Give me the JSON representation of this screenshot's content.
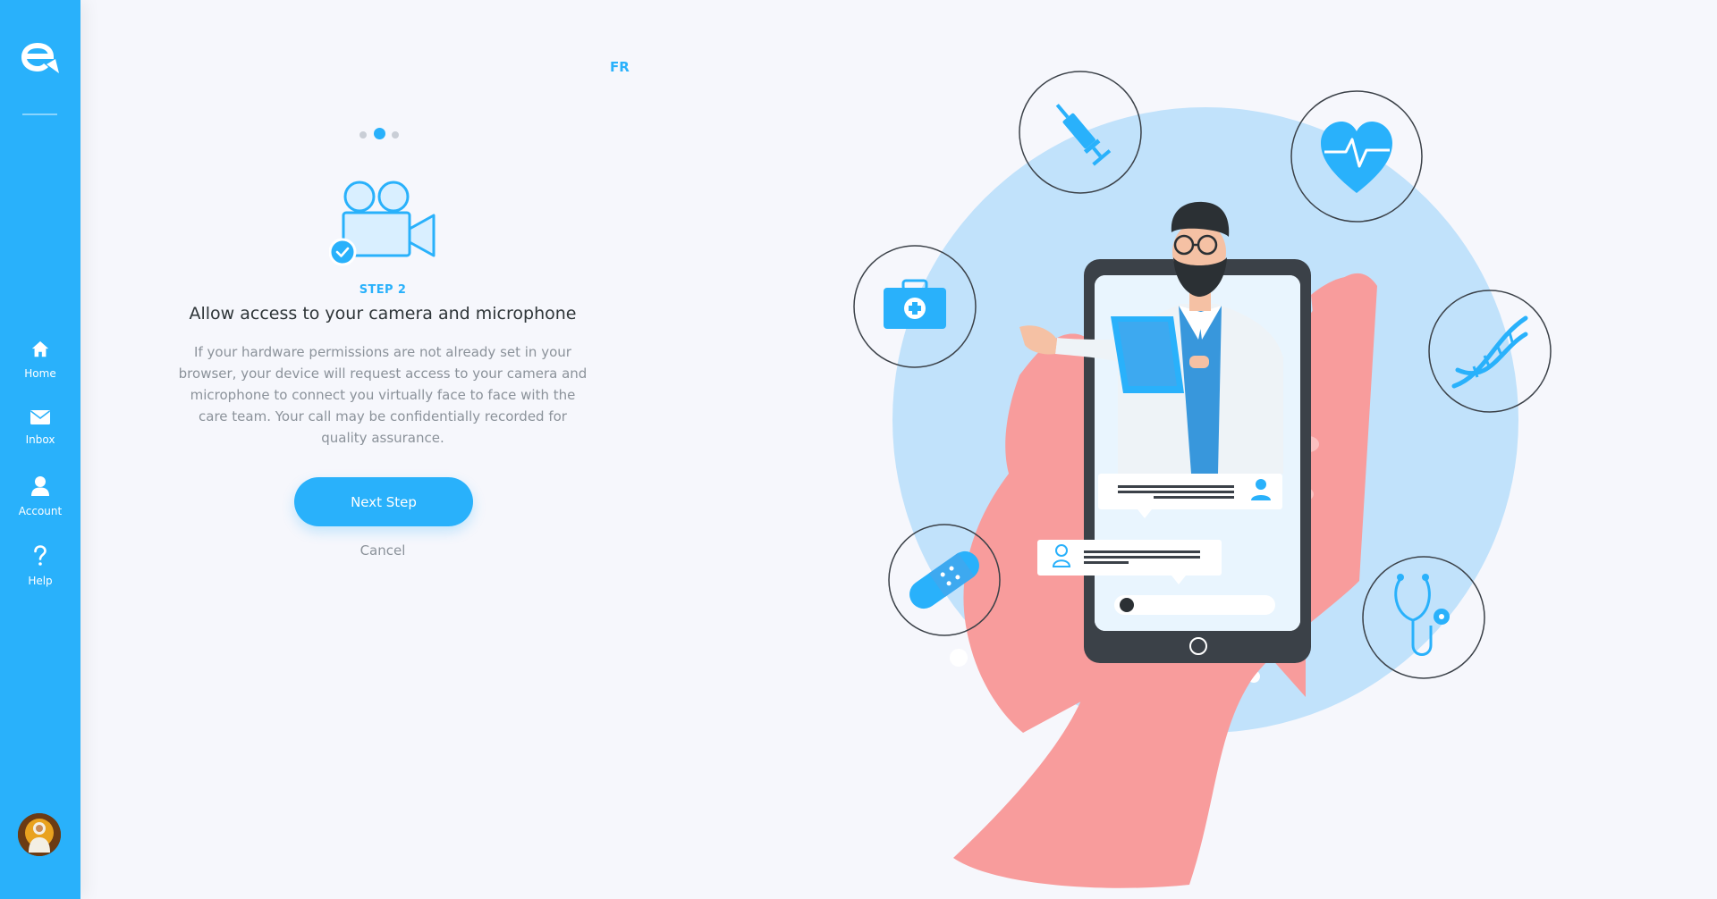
{
  "sidebar": {
    "items": [
      {
        "label": "Home"
      },
      {
        "label": "Inbox"
      },
      {
        "label": "Account"
      },
      {
        "label": "Help"
      }
    ]
  },
  "language_toggle": "FR",
  "stepper": {
    "total": 3,
    "current": 2
  },
  "step": {
    "label": "STEP 2",
    "title": "Allow access to your camera and microphone",
    "description": "If your hardware permissions are not already set in your browser, your device will request access to your camera and microphone to connect you virtually face to face with the care team. Your call may be confidentially recorded for quality assurance."
  },
  "actions": {
    "next": "Next Step",
    "cancel": "Cancel"
  },
  "colors": {
    "primary": "#29b1fb",
    "background": "#f6f7fc",
    "text_dark": "#2e3538",
    "text_muted": "#8b929a"
  },
  "icons": [
    "logo-icon",
    "home-icon",
    "mail-icon",
    "user-icon",
    "help-icon",
    "video-camera-icon",
    "check-icon"
  ]
}
